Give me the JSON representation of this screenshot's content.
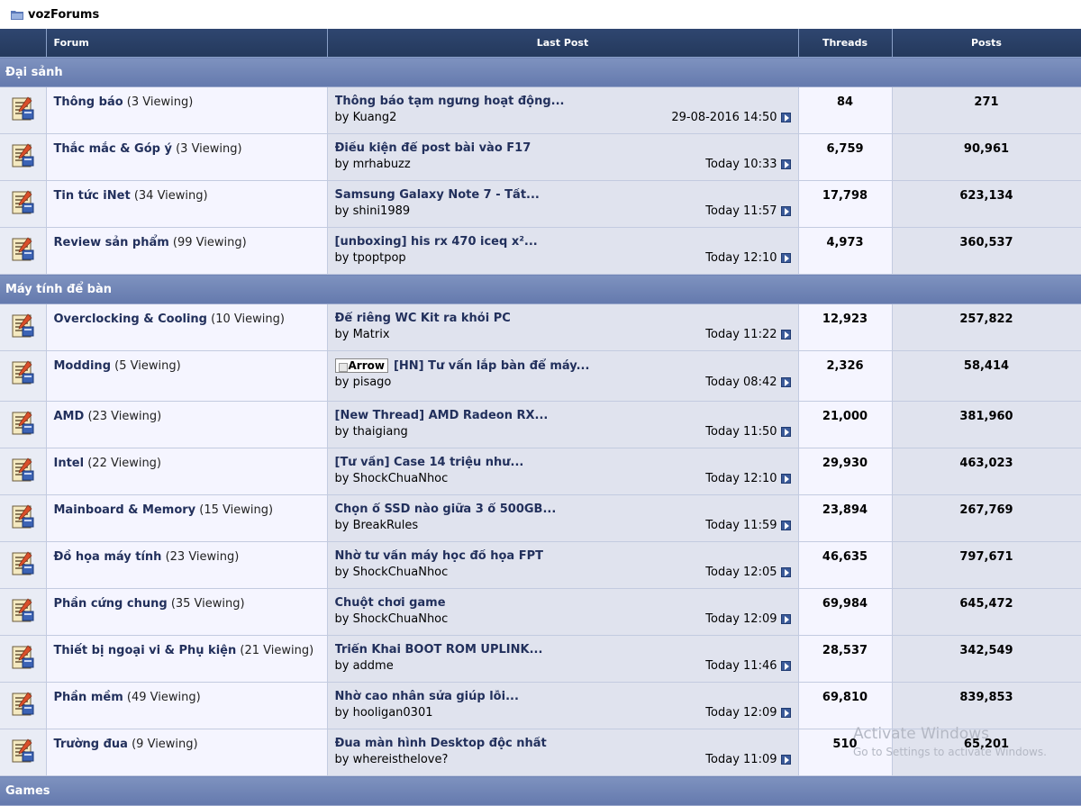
{
  "site": {
    "title": "vozForums",
    "icon": "folder-icon"
  },
  "columns": {
    "forum": "Forum",
    "last_post": "Last Post",
    "threads": "Threads",
    "posts": "Posts"
  },
  "categories": [
    {
      "name": "Đại sảnh",
      "forums": [
        {
          "name": "Thông báo",
          "viewing": "(3 Viewing)",
          "last_title": "Thông báo tạm ngưng hoạt động...",
          "last_by": "by Kuang2",
          "last_time": "29-08-2016 14:50",
          "threads": "84",
          "posts": "271"
        },
        {
          "name": "Thắc mắc & Góp ý",
          "viewing": "(3 Viewing)",
          "last_title": "Điều kiện để post bài vào F17",
          "last_by": "by mrhabuzz",
          "last_time": "Today 10:33",
          "threads": "6,759",
          "posts": "90,961"
        },
        {
          "name": "Tin tức iNet",
          "viewing": "(34 Viewing)",
          "last_title": "Samsung Galaxy Note 7 - Tất...",
          "last_by": "by shini1989",
          "last_time": "Today 11:57",
          "threads": "17,798",
          "posts": "623,134"
        },
        {
          "name": "Review sản phẩm",
          "viewing": "(99 Viewing)",
          "last_title": "[unboxing] his rx 470 iceq x²...",
          "last_by": "by tpoptpop",
          "last_time": "Today 12:10",
          "threads": "4,973",
          "posts": "360,537"
        }
      ]
    },
    {
      "name": "Máy tính để bàn",
      "forums": [
        {
          "name": "Overclocking & Cooling",
          "viewing": "(10 Viewing)",
          "last_title": "Để riêng WC Kit ra khỏi PC",
          "last_by": "by Matrix",
          "last_time": "Today 11:22",
          "threads": "12,923",
          "posts": "257,822"
        },
        {
          "name": "Modding",
          "viewing": "(5 Viewing)",
          "last_img_alt": "Arrow",
          "last_title": "[HN] Tư vấn lắp bàn để máy...",
          "last_by": "by pisago",
          "last_time": "Today 08:42",
          "threads": "2,326",
          "posts": "58,414"
        },
        {
          "name": "AMD",
          "viewing": "(23 Viewing)",
          "last_title": "[New Thread] AMD Radeon RX...",
          "last_by": "by thaigiang",
          "last_time": "Today 11:50",
          "threads": "21,000",
          "posts": "381,960"
        },
        {
          "name": "Intel",
          "viewing": "(22 Viewing)",
          "last_title": "[Tư vấn] Case 14 triệu như...",
          "last_by": "by ShockChuaNhoc",
          "last_time": "Today 12:10",
          "threads": "29,930",
          "posts": "463,023"
        },
        {
          "name": "Mainboard & Memory",
          "viewing": "(15 Viewing)",
          "last_title": "Chọn ổ SSD nào giữa 3 ổ 500GB...",
          "last_by": "by BreakRules",
          "last_time": "Today 11:59",
          "threads": "23,894",
          "posts": "267,769"
        },
        {
          "name": "Đồ họa máy tính",
          "viewing": "(23 Viewing)",
          "last_title": "Nhờ tư vấn máy học đồ họa FPT",
          "last_by": "by ShockChuaNhoc",
          "last_time": "Today 12:05",
          "threads": "46,635",
          "posts": "797,671"
        },
        {
          "name": "Phần cứng chung",
          "viewing": "(35 Viewing)",
          "last_title": "Chuột chơi game",
          "last_by": "by ShockChuaNhoc",
          "last_time": "Today 12:09",
          "threads": "69,984",
          "posts": "645,472"
        },
        {
          "name": "Thiết bị ngoại vi & Phụ kiện",
          "viewing": "(21 Viewing)",
          "last_title": "Triển Khai BOOT ROM UPLINK...",
          "last_by": "by addme",
          "last_time": "Today 11:46",
          "threads": "28,537",
          "posts": "342,549"
        },
        {
          "name": "Phần mềm",
          "viewing": "(49 Viewing)",
          "last_title": "Nhờ cao nhân sửa giúp lỗi...",
          "last_by": "by hooligan0301",
          "last_time": "Today 12:09",
          "threads": "69,810",
          "posts": "839,853"
        },
        {
          "name": "Trường đua",
          "viewing": "(9 Viewing)",
          "last_title": "Đua màn hình Desktop độc nhất",
          "last_by": "by whereisthelove?",
          "last_time": "Today 11:09",
          "threads": "510",
          "posts": "65,201"
        }
      ]
    },
    {
      "name": "Games",
      "forums": []
    }
  ],
  "watermark": {
    "line1": "Activate Windows",
    "line2": "Go to Settings to activate Windows."
  }
}
